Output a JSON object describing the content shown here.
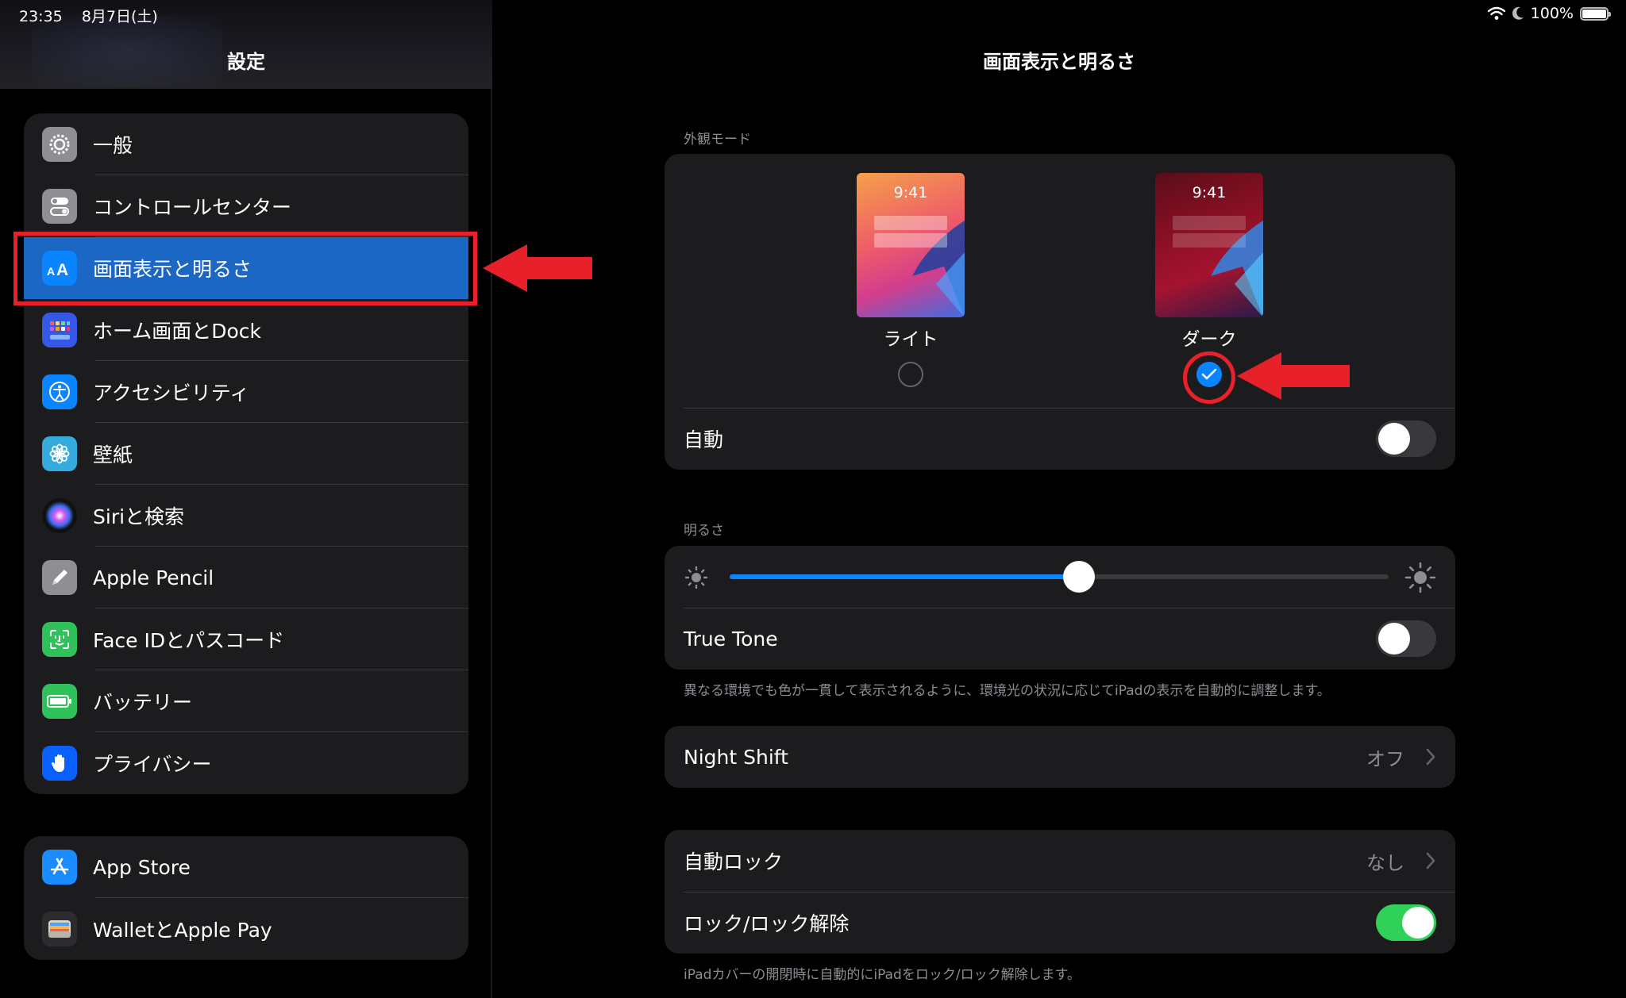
{
  "status_bar": {
    "time": "23:35",
    "date": "8月7日(土)",
    "battery": "100%"
  },
  "sidebar": {
    "title": "設定",
    "items": [
      {
        "label": "一般",
        "icon": "gear-icon",
        "color": "#8e8e93"
      },
      {
        "label": "コントロールセンター",
        "icon": "switches-icon",
        "color": "#8e8e93"
      },
      {
        "label": "画面表示と明るさ",
        "icon": "text-size-icon",
        "color": "#0a84ff"
      },
      {
        "label": "ホーム画面とDock",
        "icon": "grid-icon",
        "color": "#3757e6"
      },
      {
        "label": "アクセシビリティ",
        "icon": "accessibility-icon",
        "color": "#0a84ff"
      },
      {
        "label": "壁紙",
        "icon": "flower-icon",
        "color": "#35aadc"
      },
      {
        "label": "Siriと検索",
        "icon": "siri-icon",
        "color": "#222"
      },
      {
        "label": "Apple Pencil",
        "icon": "pencil-icon",
        "color": "#8e8e93"
      },
      {
        "label": "Face IDとパスコード",
        "icon": "faceid-icon",
        "color": "#30c15b"
      },
      {
        "label": "バッテリー",
        "icon": "battery-icon",
        "color": "#30c15b"
      },
      {
        "label": "プライバシー",
        "icon": "hand-icon",
        "color": "#0a60ff"
      }
    ],
    "apps": [
      {
        "label": "App Store",
        "icon": "appstore-icon",
        "color": "#1a8cff"
      },
      {
        "label": "WalletとApple Pay",
        "icon": "wallet-icon",
        "color": "#2c2c2e"
      }
    ]
  },
  "main": {
    "title": "画面表示と明るさ",
    "appearance": {
      "section_label": "外観モード",
      "light": {
        "label": "ライト",
        "time": "9:41",
        "selected": false
      },
      "dark": {
        "label": "ダーク",
        "time": "9:41",
        "selected": true
      },
      "auto": {
        "label": "自動",
        "on": false
      }
    },
    "brightness": {
      "section_label": "明るさ",
      "level": 0.53,
      "true_tone": {
        "label": "True Tone",
        "on": false
      },
      "footnote": "異なる環境でも色が一貫して表示されるように、環境光の状況に応じてiPadの表示を自動的に調整します。"
    },
    "night_shift": {
      "label": "Night Shift",
      "value": "オフ"
    },
    "lock": {
      "auto_lock": {
        "label": "自動ロック",
        "value": "なし"
      },
      "lock_unlock": {
        "label": "ロック/ロック解除",
        "on": true
      },
      "footnote": "iPadカバーの開閉時に自動的にiPadをロック/ロック解除します。"
    }
  },
  "colors": {
    "accent": "#0a84ff",
    "selected_row": "#1c66c4",
    "annotation": "#e8202a",
    "toggle_on": "#30d158"
  }
}
